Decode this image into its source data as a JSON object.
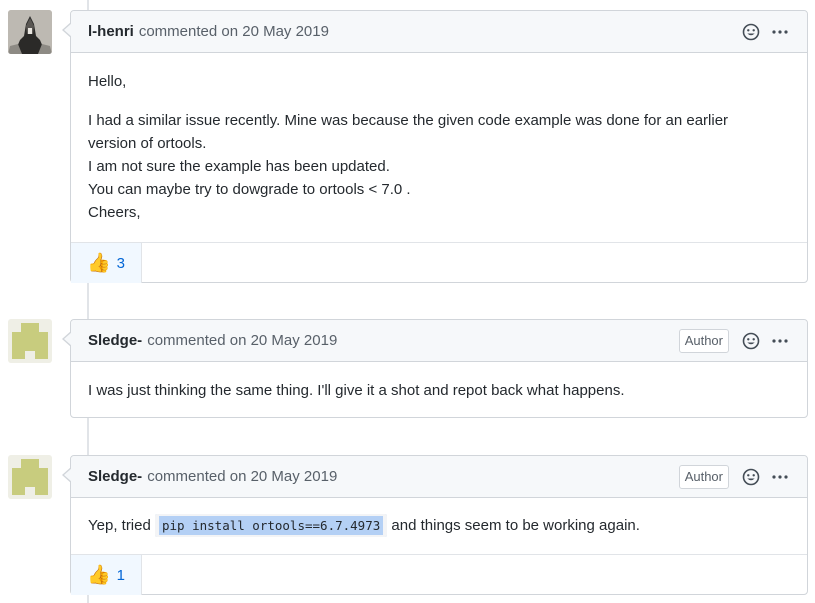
{
  "comments": [
    {
      "author": "l-henri",
      "meta": "commented on 20 May 2019",
      "is_author": false,
      "body": [
        [
          "Hello,"
        ],
        [
          "I had a similar issue recently. Mine was because the given code example was done for an earlier",
          "version of ortools.",
          "I am not sure the example has been updated.",
          "You can maybe try to dowgrade to ortools < 7.0 .",
          "Cheers,"
        ]
      ],
      "reaction": {
        "emoji": "👍",
        "count": "3"
      }
    },
    {
      "author": "Sledge-",
      "meta": "commented on 20 May 2019",
      "is_author": true,
      "badge": "Author",
      "body": "I was just thinking the same thing. I'll give it a shot and repot back what happens."
    },
    {
      "author": "Sledge-",
      "meta": "commented on 20 May 2019",
      "is_author": true,
      "badge": "Author",
      "body_prefix": "Yep, tried ",
      "body_code": "pip install ortools==6.7.4973",
      "body_suffix": " and things seem to be working again.",
      "reaction": {
        "emoji": "👍",
        "count": "1"
      }
    }
  ],
  "icons": {
    "emoji_picker": "smiley-icon",
    "more": "kebab-horizontal-icon"
  },
  "colors": {
    "link_blue": "#0366d6",
    "header_bg": "#f6f8fa",
    "border": "#d1d5da",
    "reaction_bg": "#f1f8ff",
    "code_highlight": "#b4d0f5"
  }
}
